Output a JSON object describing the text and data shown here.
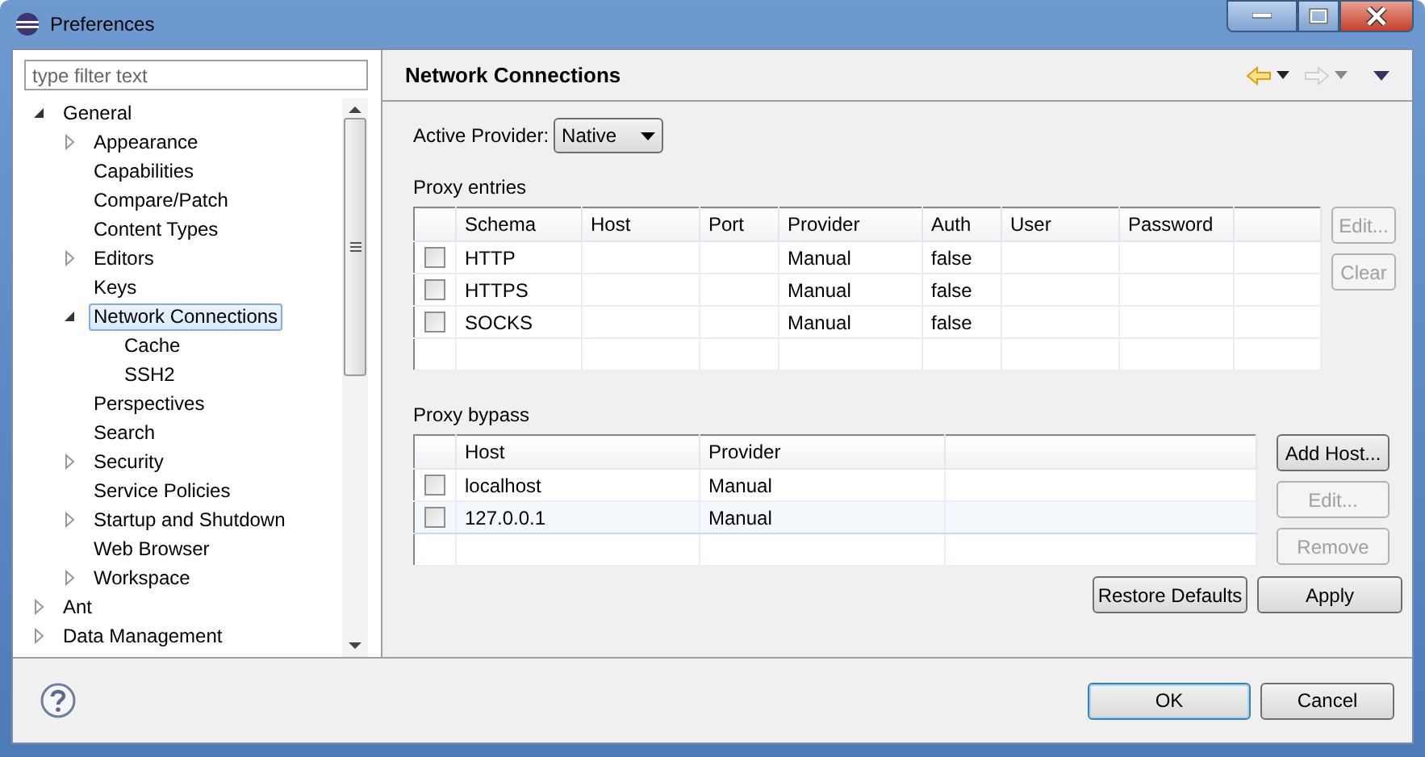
{
  "window": {
    "title": "Preferences"
  },
  "filter": {
    "placeholder": "type filter text"
  },
  "tree": [
    {
      "label": "General",
      "kind": "folder",
      "expanded": true,
      "selected": false,
      "children": [
        {
          "label": "Appearance",
          "kind": "folder",
          "expanded": false,
          "selected": false
        },
        {
          "label": "Capabilities",
          "kind": "leaf",
          "selected": false
        },
        {
          "label": "Compare/Patch",
          "kind": "leaf",
          "selected": false
        },
        {
          "label": "Content Types",
          "kind": "leaf",
          "selected": false
        },
        {
          "label": "Editors",
          "kind": "folder",
          "expanded": false,
          "selected": false
        },
        {
          "label": "Keys",
          "kind": "leaf",
          "selected": false
        },
        {
          "label": "Network Connections",
          "kind": "folder",
          "expanded": true,
          "selected": true,
          "children": [
            {
              "label": "Cache",
              "kind": "leaf",
              "selected": false
            },
            {
              "label": "SSH2",
              "kind": "leaf",
              "selected": false
            }
          ]
        },
        {
          "label": "Perspectives",
          "kind": "leaf",
          "selected": false
        },
        {
          "label": "Search",
          "kind": "leaf",
          "selected": false
        },
        {
          "label": "Security",
          "kind": "folder",
          "expanded": false,
          "selected": false
        },
        {
          "label": "Service Policies",
          "kind": "leaf",
          "selected": false
        },
        {
          "label": "Startup and Shutdown",
          "kind": "folder",
          "expanded": false,
          "selected": false
        },
        {
          "label": "Web Browser",
          "kind": "leaf",
          "selected": false
        },
        {
          "label": "Workspace",
          "kind": "folder",
          "expanded": false,
          "selected": false
        }
      ]
    },
    {
      "label": "Ant",
      "kind": "folder",
      "expanded": false,
      "selected": false
    },
    {
      "label": "Data Management",
      "kind": "folder",
      "expanded": false,
      "selected": false
    }
  ],
  "page": {
    "title": "Network Connections",
    "history": [
      {
        "kind": "back",
        "disabled": false
      },
      {
        "kind": "forward",
        "disabled": true
      }
    ],
    "active_provider": {
      "label": "Active Provider:",
      "value": "Native"
    },
    "proxy_entries": {
      "label": "Proxy entries",
      "columns": [
        "Schema",
        "Host",
        "Port",
        "Provider",
        "Auth",
        "User",
        "Password"
      ],
      "rows": [
        {
          "checked": false,
          "schema": "HTTP",
          "provider": "Manual",
          "auth": "false"
        },
        {
          "checked": false,
          "schema": "HTTPS",
          "provider": "Manual",
          "auth": "false"
        },
        {
          "checked": false,
          "schema": "SOCKS",
          "provider": "Manual",
          "auth": "false"
        }
      ],
      "buttons": [
        {
          "label": "Edit...",
          "disabled": true
        },
        {
          "label": "Clear",
          "disabled": true
        }
      ]
    },
    "proxy_bypass": {
      "label": "Proxy bypass",
      "columns": [
        "Host",
        "Provider"
      ],
      "rows": [
        {
          "checked": false,
          "selected": false,
          "host": "localhost",
          "provider": "Manual"
        },
        {
          "checked": false,
          "selected": true,
          "host": "127.0.0.1",
          "provider": "Manual"
        }
      ],
      "buttons": [
        {
          "label": "Add Host...",
          "disabled": false
        },
        {
          "label": "Edit...",
          "disabled": true
        },
        {
          "label": "Remove",
          "disabled": true
        }
      ]
    },
    "buttons": [
      {
        "label": "Restore Defaults"
      },
      {
        "label": "Apply"
      }
    ]
  },
  "dialog_buttons": [
    {
      "label": "OK",
      "default": true
    },
    {
      "label": "Cancel",
      "default": false
    }
  ]
}
